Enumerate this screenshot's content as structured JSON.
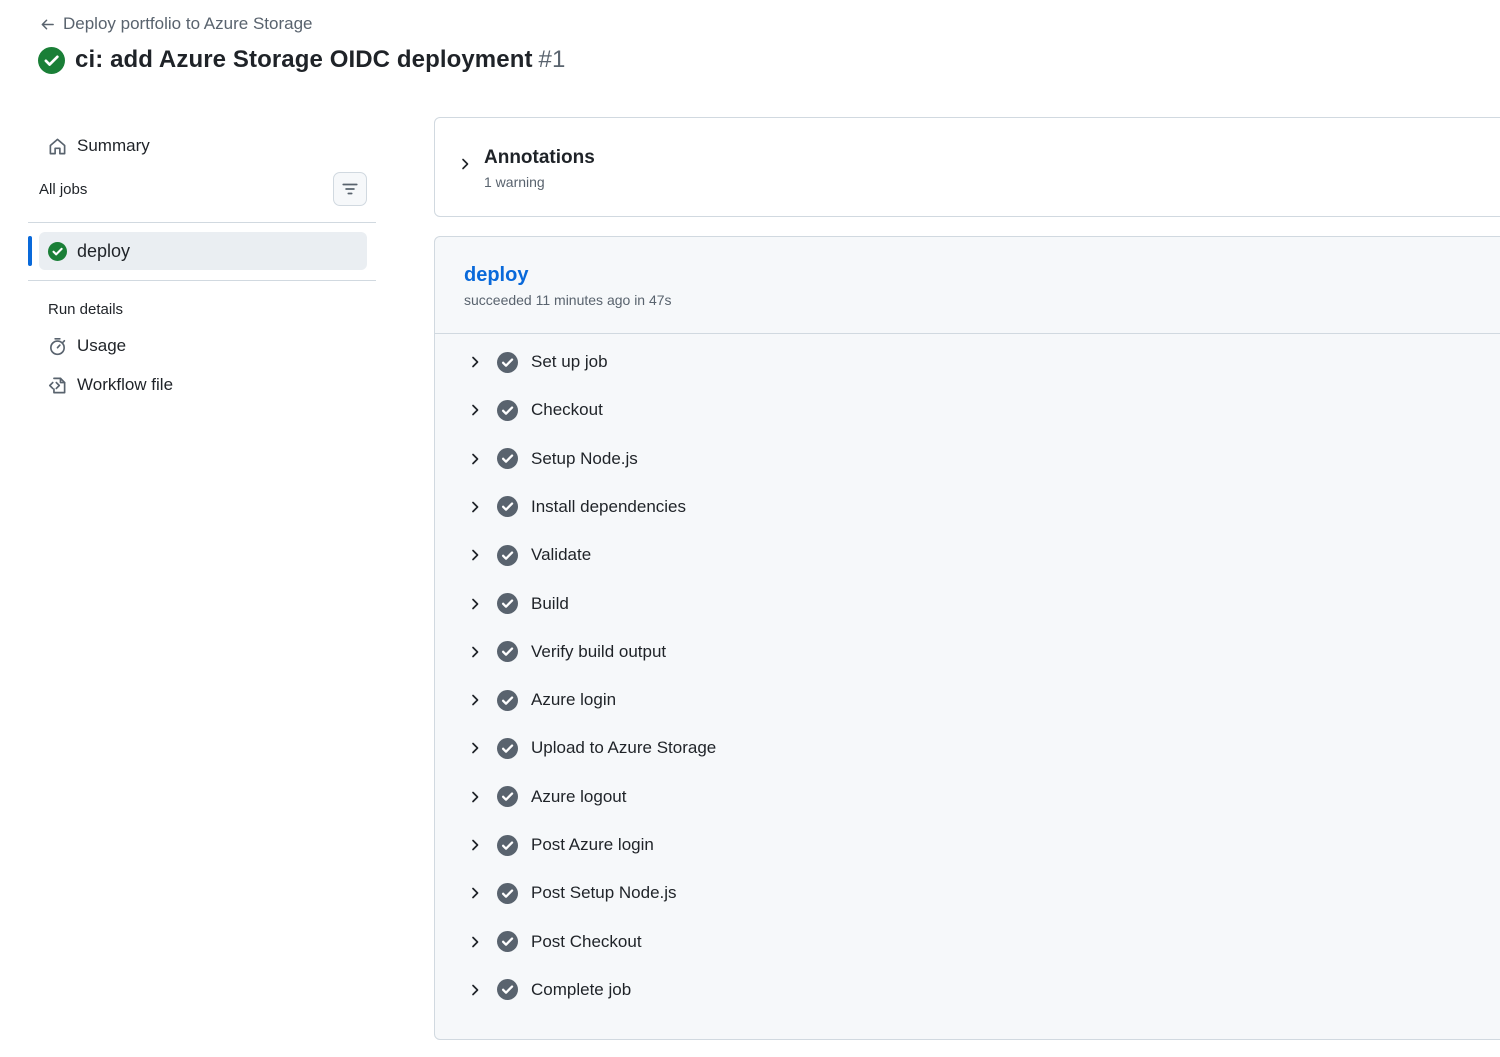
{
  "header": {
    "back_label": "Deploy portfolio to Azure Storage",
    "title": "ci: add Azure Storage OIDC deployment",
    "run_number": "#1",
    "status": "success"
  },
  "sidebar": {
    "summary_label": "Summary",
    "all_jobs_label": "All jobs",
    "jobs": [
      {
        "name": "deploy",
        "status": "success",
        "selected": true
      }
    ],
    "run_details_label": "Run details",
    "usage_label": "Usage",
    "workflow_file_label": "Workflow file"
  },
  "annotations": {
    "title": "Annotations",
    "subtitle": "1 warning"
  },
  "job": {
    "name": "deploy",
    "meta": "succeeded 11 minutes ago in 47s",
    "steps": [
      {
        "label": "Set up job"
      },
      {
        "label": "Checkout"
      },
      {
        "label": "Setup Node.js"
      },
      {
        "label": "Install dependencies"
      },
      {
        "label": "Validate"
      },
      {
        "label": "Build"
      },
      {
        "label": "Verify build output"
      },
      {
        "label": "Azure login"
      },
      {
        "label": "Upload to Azure Storage"
      },
      {
        "label": "Azure logout"
      },
      {
        "label": "Post Azure login"
      },
      {
        "label": "Post Setup Node.js"
      },
      {
        "label": "Post Checkout"
      },
      {
        "label": "Complete job"
      }
    ]
  },
  "colors": {
    "success_green": "#1a7f37",
    "step_check_gray": "#59636e",
    "link_blue": "#0969da",
    "selected_indicator": "#0969da"
  }
}
